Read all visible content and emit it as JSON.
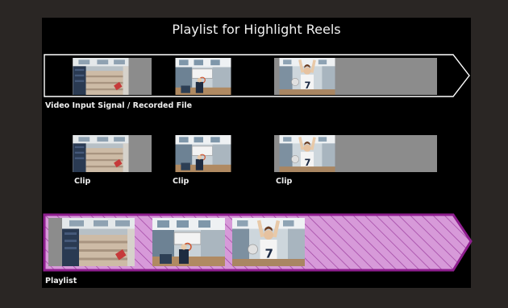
{
  "title": "Playlist for Highlight Reels",
  "labels": {
    "input_signal": "Video Input Signal / Recorded File",
    "clip_1": "Clip",
    "clip_2": "Clip",
    "clip_3": "Clip",
    "playlist": "Playlist"
  },
  "colors": {
    "background": "#2a2624",
    "panel": "#000000",
    "playlist_fill": "#d79ad9",
    "playlist_border": "#8e1e8e",
    "clip_gray": "#8c8c8c",
    "outline": "#ffffff"
  },
  "icons": [
    "thumbnail-warehouse",
    "thumbnail-gym",
    "thumbnail-player"
  ]
}
